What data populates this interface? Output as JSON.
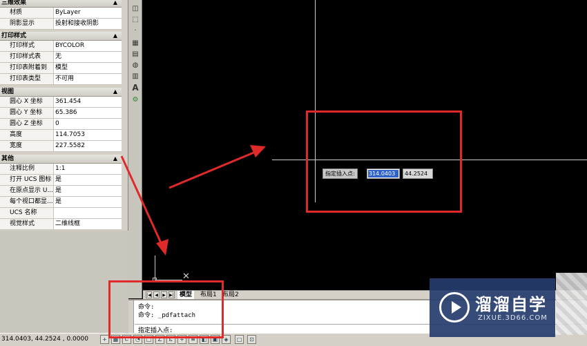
{
  "palette": {
    "groups": [
      {
        "title": "三维效果",
        "rows": [
          {
            "key": "材质",
            "value": "ByLayer"
          },
          {
            "key": "阴影显示",
            "value": "投射和接收阴影"
          }
        ]
      },
      {
        "title": "打印样式",
        "rows": [
          {
            "key": "打印样式",
            "value": "BYCOLOR"
          },
          {
            "key": "打印样式表",
            "value": "无"
          },
          {
            "key": "打印表附着到",
            "value": "模型"
          },
          {
            "key": "打印表类型",
            "value": "不可用"
          }
        ]
      },
      {
        "title": "视图",
        "rows": [
          {
            "key": "圆心 X 坐标",
            "value": "361.454"
          },
          {
            "key": "圆心 Y 坐标",
            "value": "65.386"
          },
          {
            "key": "圆心 Z 坐标",
            "value": "0"
          },
          {
            "key": "高度",
            "value": "114.7053"
          },
          {
            "key": "宽度",
            "value": "227.5582"
          }
        ]
      },
      {
        "title": "其他",
        "rows": [
          {
            "key": "注释比例",
            "value": "1:1"
          },
          {
            "key": "打开 UCS 图标",
            "value": "是"
          },
          {
            "key": "在原点显示 U...",
            "value": "是"
          },
          {
            "key": "每个视口都显...",
            "value": "是"
          },
          {
            "key": "UCS 名称",
            "value": ""
          },
          {
            "key": "视觉样式",
            "value": "二维线框"
          }
        ]
      }
    ]
  },
  "toolbar": {
    "icons": [
      "region-icon",
      "hatch-icon",
      "point-icon",
      "table-grid-icon",
      "gradient-icon",
      "boundary-icon",
      "table-icon",
      "text-icon",
      "add-selected-icon"
    ],
    "text_tool_label": "A"
  },
  "canvas": {
    "prompt_label": "指定插入点:",
    "x_value": "314.0403",
    "y_value": "44.2524"
  },
  "tabs": {
    "items": [
      "模型",
      "布局1",
      "布局2"
    ],
    "active": "模型"
  },
  "command": {
    "lines": [
      "命令:",
      "命令: _pdfattach"
    ],
    "prompt": "指定插入点:"
  },
  "status": {
    "coordinates": "314.0403, 44.2524 , 0.0000"
  },
  "watermark": {
    "title": "溜溜自学",
    "url": "ZIXUE.3D66.COM"
  },
  "colors": {
    "highlight": "#e02a2a",
    "selection": "#2f63c8",
    "watermark_bg": "#263c6e"
  }
}
